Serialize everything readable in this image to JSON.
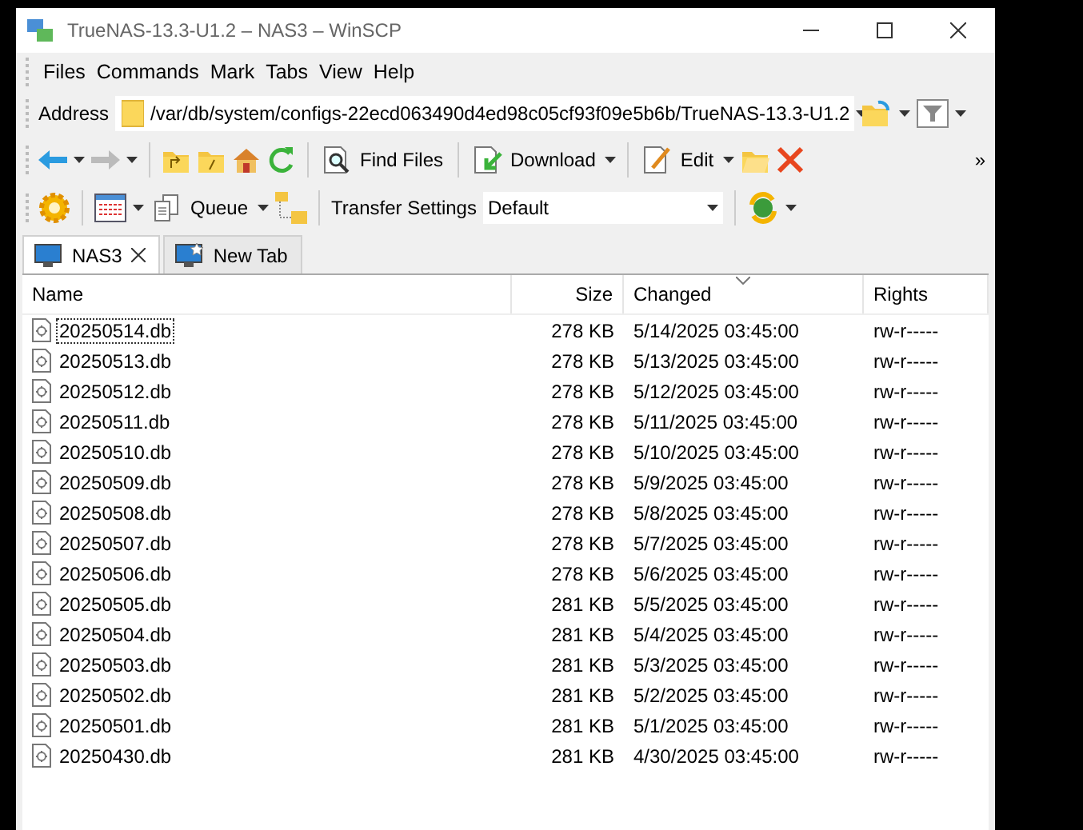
{
  "window": {
    "title": "TrueNAS-13.3-U1.2 – NAS3 – WinSCP"
  },
  "menu": [
    "Files",
    "Commands",
    "Mark",
    "Tabs",
    "View",
    "Help"
  ],
  "address": {
    "label": "Address",
    "value": "/var/db/system/configs-22ecd063490d4ed98c05cf93f09e5b6b/TrueNAS-13.3-U1.2"
  },
  "toolbar": {
    "back": {
      "disabled": false
    },
    "forward": {
      "disabled": true
    },
    "find_files": "Find Files",
    "download": "Download",
    "edit": "Edit",
    "overflow": "»"
  },
  "toolbar2": {
    "queue": "Queue",
    "transfer_settings_label": "Transfer Settings",
    "transfer_settings_value": "Default"
  },
  "tabs": [
    {
      "label": "NAS3",
      "selected": true,
      "closable": true
    },
    {
      "label": "New Tab",
      "selected": false,
      "closable": false
    }
  ],
  "table": {
    "columns": [
      {
        "label": "Name",
        "sorted": false
      },
      {
        "label": "Size",
        "sorted": false
      },
      {
        "label": "Changed",
        "sorted": true
      },
      {
        "label": "Rights",
        "sorted": false
      }
    ],
    "rows": [
      {
        "name": "20250514.db",
        "size": "278 KB",
        "changed": "5/14/2025 03:45:00",
        "rights": "rw-r-----",
        "focused": true
      },
      {
        "name": "20250513.db",
        "size": "278 KB",
        "changed": "5/13/2025 03:45:00",
        "rights": "rw-r-----",
        "focused": false
      },
      {
        "name": "20250512.db",
        "size": "278 KB",
        "changed": "5/12/2025 03:45:00",
        "rights": "rw-r-----",
        "focused": false
      },
      {
        "name": "20250511.db",
        "size": "278 KB",
        "changed": "5/11/2025 03:45:00",
        "rights": "rw-r-----",
        "focused": false
      },
      {
        "name": "20250510.db",
        "size": "278 KB",
        "changed": "5/10/2025 03:45:00",
        "rights": "rw-r-----",
        "focused": false
      },
      {
        "name": "20250509.db",
        "size": "278 KB",
        "changed": "5/9/2025 03:45:00",
        "rights": "rw-r-----",
        "focused": false
      },
      {
        "name": "20250508.db",
        "size": "278 KB",
        "changed": "5/8/2025 03:45:00",
        "rights": "rw-r-----",
        "focused": false
      },
      {
        "name": "20250507.db",
        "size": "278 KB",
        "changed": "5/7/2025 03:45:00",
        "rights": "rw-r-----",
        "focused": false
      },
      {
        "name": "20250506.db",
        "size": "278 KB",
        "changed": "5/6/2025 03:45:00",
        "rights": "rw-r-----",
        "focused": false
      },
      {
        "name": "20250505.db",
        "size": "281 KB",
        "changed": "5/5/2025 03:45:00",
        "rights": "rw-r-----",
        "focused": false
      },
      {
        "name": "20250504.db",
        "size": "281 KB",
        "changed": "5/4/2025 03:45:00",
        "rights": "rw-r-----",
        "focused": false
      },
      {
        "name": "20250503.db",
        "size": "281 KB",
        "changed": "5/3/2025 03:45:00",
        "rights": "rw-r-----",
        "focused": false
      },
      {
        "name": "20250502.db",
        "size": "281 KB",
        "changed": "5/2/2025 03:45:00",
        "rights": "rw-r-----",
        "focused": false
      },
      {
        "name": "20250501.db",
        "size": "281 KB",
        "changed": "5/1/2025 03:45:00",
        "rights": "rw-r-----",
        "focused": false
      },
      {
        "name": "20250430.db",
        "size": "281 KB",
        "changed": "4/30/2025 03:45:00",
        "rights": "rw-r-----",
        "focused": false
      }
    ]
  }
}
